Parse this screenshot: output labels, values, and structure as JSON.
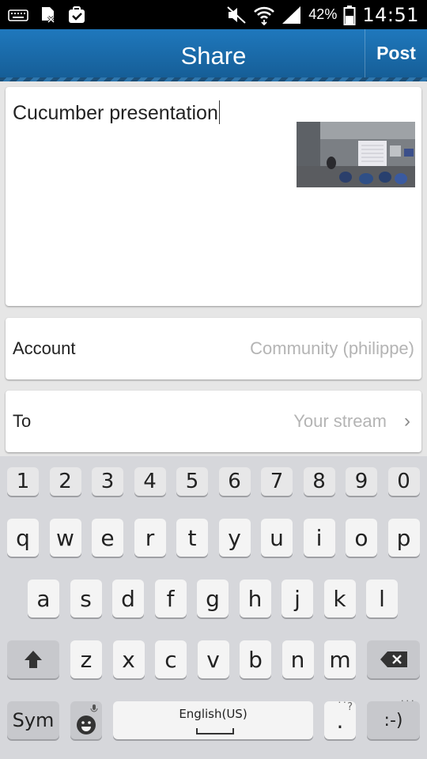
{
  "status_bar": {
    "battery_percent": "42%",
    "time": "14:51"
  },
  "action_bar": {
    "title": "Share",
    "post_label": "Post"
  },
  "message": {
    "text": "Cucumber presentation"
  },
  "account": {
    "label": "Account",
    "value": "Community (philippe)"
  },
  "recipient": {
    "label": "To",
    "value": "Your stream"
  },
  "keyboard": {
    "numbers": [
      "1",
      "2",
      "3",
      "4",
      "5",
      "6",
      "7",
      "8",
      "9",
      "0"
    ],
    "row1": [
      "q",
      "w",
      "e",
      "r",
      "t",
      "y",
      "u",
      "i",
      "o",
      "p"
    ],
    "row2": [
      "a",
      "s",
      "d",
      "f",
      "g",
      "h",
      "j",
      "k",
      "l"
    ],
    "row3": [
      "z",
      "x",
      "c",
      "v",
      "b",
      "n",
      "m"
    ],
    "sym_label": "Sym",
    "space_label": "English(US)",
    "period_label": ".",
    "smiley_label": ":-)"
  },
  "colors": {
    "action_bar": "#1a6aa9",
    "status_bar": "#000000",
    "keyboard_bg": "#d6d7db"
  }
}
